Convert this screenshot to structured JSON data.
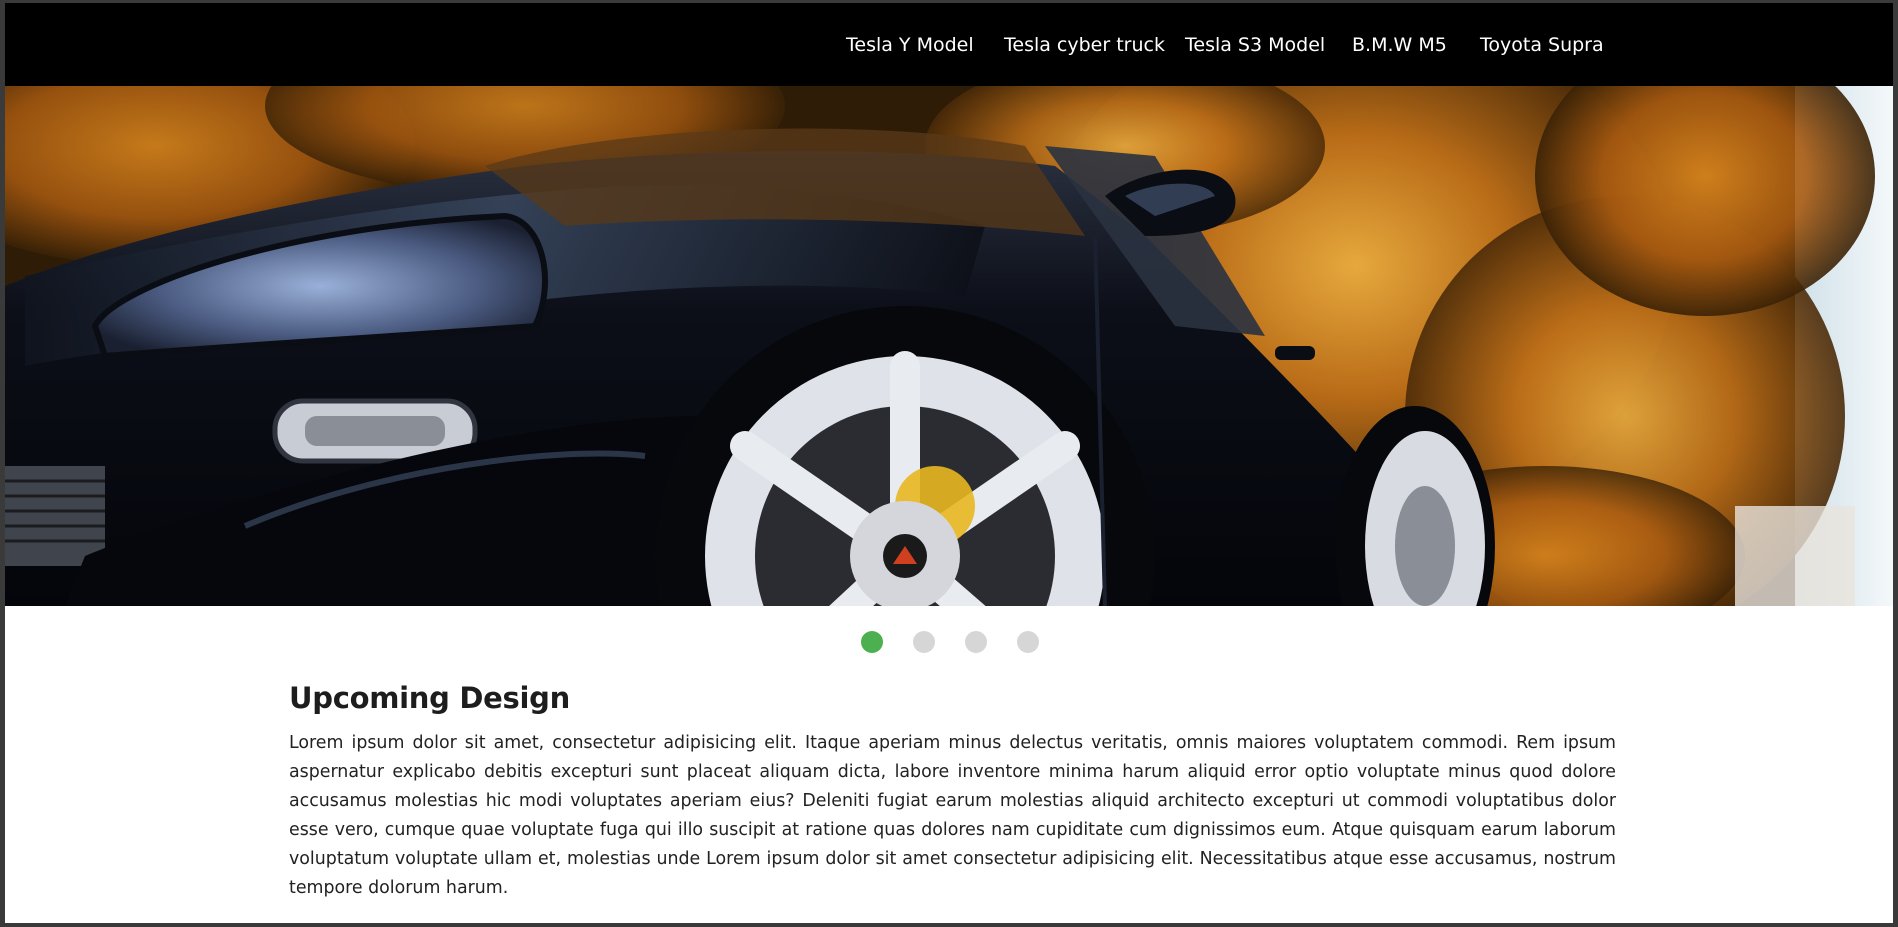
{
  "nav": {
    "items": [
      {
        "label": "Tesla Y Model"
      },
      {
        "label": "Tesla cyber truck"
      },
      {
        "label": "Tesla S3 Model"
      },
      {
        "label": "B.M.W M5"
      },
      {
        "label": "Toyota Supra"
      }
    ]
  },
  "carousel": {
    "slide_count": 4,
    "active_index": 0,
    "active_color": "#4caf50",
    "inactive_color": "#d6d6d6"
  },
  "section": {
    "title": "Upcoming Design",
    "body": "Lorem ipsum dolor sit amet, consectetur adipisicing elit. Itaque aperiam minus delectus veritatis, omnis maiores voluptatem commodi. Rem ipsum aspernatur explicabo debitis excepturi sunt placeat aliquam dicta, labore inventore minima harum aliquid error optio voluptate minus quod dolore accusamus molestias hic modi voluptates aperiam eius? Deleniti fugiat earum molestias aliquid architecto excepturi ut commodi voluptatibus dolor esse vero, cumque quae voluptate fuga qui illo suscipit at ratione quas dolores nam cupiditate cum dignissimos eum. Atque quisquam earum laborum voluptatum voluptate ullam et, molestias unde Lorem ipsum dolor sit amet consectetur adipisicing elit. Necessitatibus atque esse accusamus, nostrum tempore dolorum harum."
  },
  "colors": {
    "navbar_bg": "#000000",
    "nav_text": "#ffffff",
    "page_bg": "#ffffff"
  }
}
